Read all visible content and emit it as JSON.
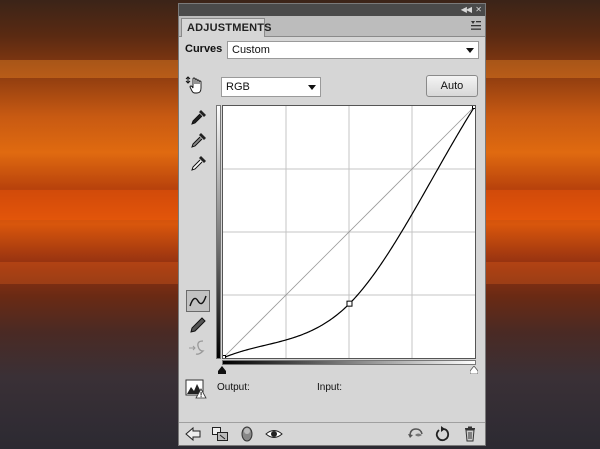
{
  "panel": {
    "tab_label": "ADJUSTMENTS",
    "preset": {
      "label": "Curves",
      "selected": "Custom"
    },
    "channel": {
      "selected": "RGB"
    },
    "auto_label": "Auto",
    "output_label": "Output:",
    "input_label": "Input:"
  },
  "curve": {
    "control_points": [
      [
        0,
        0
      ],
      [
        128,
        55
      ],
      [
        255,
        255
      ]
    ]
  },
  "colors": {
    "panel_bg": "#d6d6d6",
    "header_bg": "#4a4a4a"
  },
  "icons": {
    "tools": [
      "on-image-adjust-icon",
      "black-point-eyedropper-icon",
      "gray-point-eyedropper-icon",
      "white-point-eyedropper-icon",
      "curve-edit-points-icon",
      "pencil-draw-icon",
      "smooth-curve-icon"
    ],
    "bottom": [
      "return-to-list-icon",
      "expanded-view-icon",
      "clip-to-layer-icon",
      "visibility-eye-icon",
      "view-previous-icon",
      "reset-icon",
      "trash-icon"
    ]
  }
}
